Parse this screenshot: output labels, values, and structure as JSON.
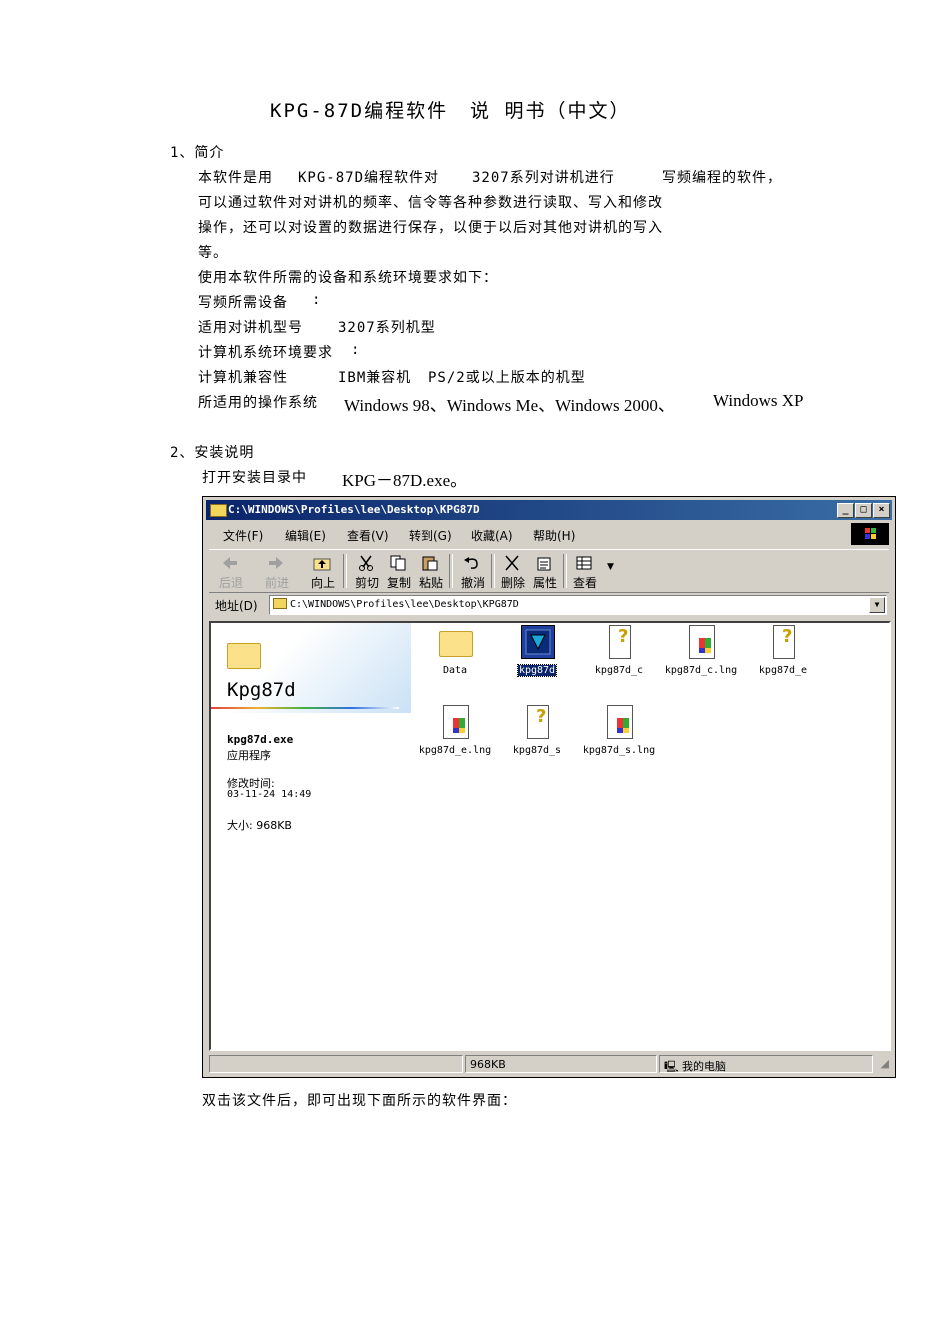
{
  "document": {
    "title_left": "KPG-87D编程软件",
    "title_right": "说 明书（中文）",
    "s1_heading": "1、简介",
    "s1_line1_a": "本软件是用",
    "s1_line1_b": "KPG-87D编程软件对",
    "s1_line1_c": "3207系列对讲机进行",
    "s1_line1_d": "写频编程的软件，",
    "s1_line2": "可以通过软件对对讲机的频率、信令等各种参数进行读取、写入和修改",
    "s1_line3": "操作，还可以对设置的数据进行保存，以便于以后对其他对讲机的写入",
    "s1_line4": "等。",
    "s1_line5": "使用本软件所需的设备和系统环境要求如下：",
    "s1_line6": "写频所需设备",
    "s1_line6_colon": ":",
    "s1_line7_a": "适用对讲机型号",
    "s1_line7_b": "3207系列机型",
    "s1_line8_a": "计算机系统环境要求",
    "s1_line8_colon": ":",
    "s1_line9_a": "计算机兼容性",
    "s1_line9_b": "IBM兼容机",
    "s1_line9_c": "PS/2或以上版本的机型",
    "s1_line10_a": "所适用的操作系统",
    "s1_line10_b": "Windows 98、Windows Me、Windows 2000、",
    "s1_line10_c": "Windows XP",
    "s2_heading": "2、安装说明",
    "s2_line1_a": "打开安装目录中",
    "s2_line1_b": "KPG－87D.exe。",
    "footer_line": "双击该文件后，即可出现下面所示的软件界面："
  },
  "explorer": {
    "title": "C:\\WINDOWS\\Profiles\\lee\\Desktop\\KPG87D",
    "menu": [
      "文件(F)",
      "编辑(E)",
      "查看(V)",
      "转到(G)",
      "收藏(A)",
      "帮助(H)"
    ],
    "toolbar": {
      "back": "后退",
      "forward": "前进",
      "up": "向上",
      "cut": "剪切",
      "copy": "复制",
      "paste": "粘贴",
      "undo": "撤消",
      "delete": "删除",
      "properties": "属性",
      "view": "查看"
    },
    "address_label": "地址(D)",
    "address_value": "C:\\WINDOWS\\Profiles\\lee\\Desktop\\KPG87D",
    "webview": {
      "folder_name": "Kpg87d",
      "file_name": "kpg87d.exe",
      "file_type": "应用程序",
      "modified_label": "修改时间:",
      "modified_value": "03-11-24 14:49",
      "size_label": "大小: 968KB"
    },
    "files": [
      {
        "name": "Data",
        "icon": "folder-icon"
      },
      {
        "name": "kpg87d",
        "icon": "application-icon"
      },
      {
        "name": "kpg87d_c",
        "icon": "help-file-icon"
      },
      {
        "name": "kpg87d_c.lng",
        "icon": "lng-file-icon"
      },
      {
        "name": "kpg87d_e",
        "icon": "help-file-icon"
      },
      {
        "name": "kpg87d_e.lng",
        "icon": "lng-file-icon"
      },
      {
        "name": "kpg87d_s",
        "icon": "help-file-icon"
      },
      {
        "name": "kpg87d_s.lng",
        "icon": "lng-file-icon"
      }
    ],
    "status": {
      "size": "968KB",
      "zone": "我的电脑"
    }
  }
}
